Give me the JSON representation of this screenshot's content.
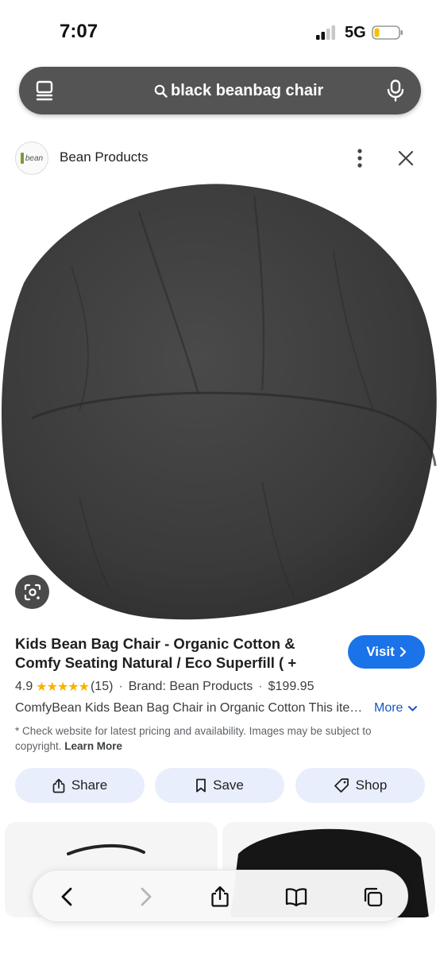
{
  "status_bar": {
    "time": "7:07",
    "network": "5G",
    "icons": [
      "cellular-signal-icon",
      "battery-icon"
    ]
  },
  "search": {
    "query": "black beanbag chair",
    "icons": [
      "tabs-icon",
      "search-icon",
      "microphone-icon"
    ]
  },
  "source": {
    "name": "Bean Products",
    "logo_text": "bean",
    "icons": [
      "more-options-icon",
      "close-icon"
    ]
  },
  "image": {
    "alt": "black beanbag chair",
    "lens_icon": "visual-search-icon"
  },
  "product": {
    "title": "Kids Bean Bag Chair - Organic Cotton & Comfy Seating Natural / Eco Superfill ( +",
    "visit_label": "Visit",
    "rating": "4.9",
    "stars": 5,
    "review_count": "(15)",
    "brand": "Brand: Bean Products",
    "price": "$199.95",
    "description": "ComfyBean Kids Bean Bag Chair in Organic Cotton This item is handmade",
    "more_label": "More",
    "disclaimer": "* Check website for latest pricing and availability. Images may be subject to copyright.",
    "learn_more": "Learn More"
  },
  "actions": {
    "share": "Share",
    "save": "Save",
    "shop": "Shop"
  },
  "toolbar": {
    "icons": [
      "back-icon",
      "forward-icon",
      "share-icon",
      "bookmarks-icon",
      "tabs-overview-icon"
    ]
  },
  "colors": {
    "visit_button": "#1a73e8",
    "search_bar": "#545454",
    "chip_background": "#e8eefc",
    "star": "#f5b400"
  }
}
